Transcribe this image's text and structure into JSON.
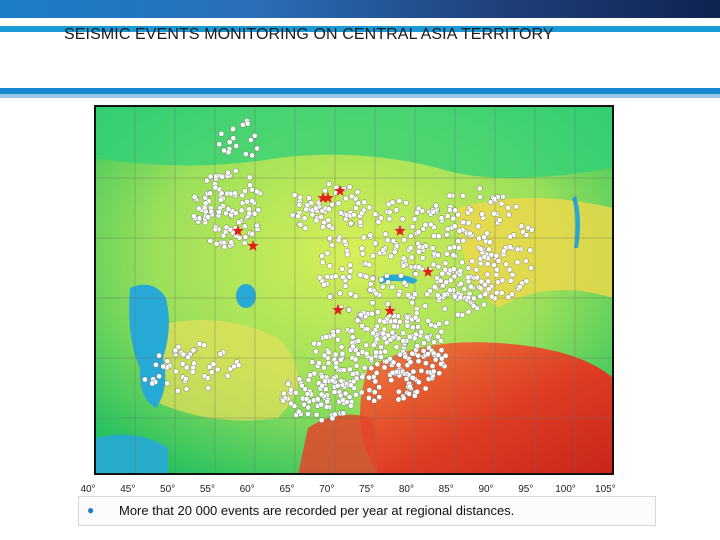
{
  "title": "SEISMIC EVENTS MONITORING ON CENTRAL ASIA TERRITORY",
  "map": {
    "lon_labels": [
      "40°",
      "45°",
      "50°",
      "55°",
      "60°",
      "65°",
      "70°",
      "75°",
      "80°",
      "85°",
      "90°",
      "95°",
      "100°",
      "105°"
    ],
    "event_marker_color": "#ffffff",
    "station_marker_color": "#e0201b"
  },
  "footer": {
    "bullet": "●",
    "text": "More that 20 000 events are recorded per year at regional distances."
  }
}
